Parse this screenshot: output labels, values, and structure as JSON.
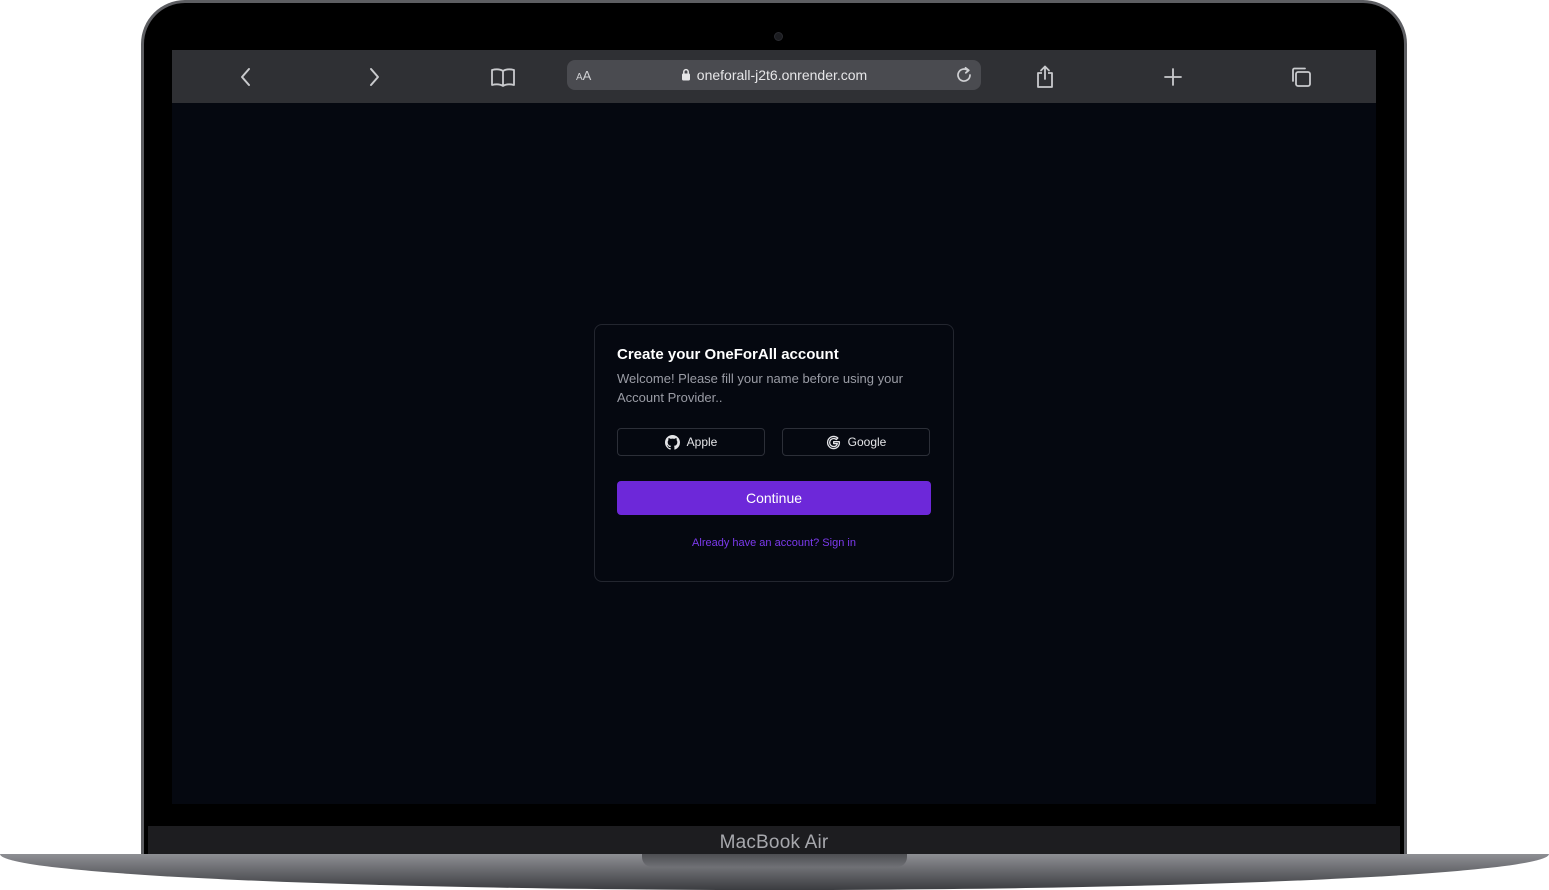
{
  "device": {
    "label": "MacBook Air"
  },
  "browser": {
    "text_size_label": "AA",
    "url": "oneforall-j2t6.onrender.com",
    "icons": {
      "back": "chevron-left-icon",
      "forward": "chevron-right-icon",
      "bookmarks": "book-icon",
      "lock": "lock-icon",
      "reload": "reload-icon",
      "share": "share-icon",
      "new_tab": "plus-icon",
      "tabs": "tabs-icon"
    }
  },
  "signup_card": {
    "title": "Create your OneForAll account",
    "subtitle": "Welcome! Please fill your name before using your Account Provider..",
    "providers": [
      {
        "label": "Apple",
        "icon": "github-icon"
      },
      {
        "label": "Google",
        "icon": "google-icon"
      }
    ],
    "continue_label": "Continue",
    "signin_link": "Already have an account? Sign in"
  },
  "colors": {
    "accent": "#6d28d9",
    "link": "#7c3aed",
    "page_background": "#050810",
    "toolbar": "#2f3034"
  }
}
